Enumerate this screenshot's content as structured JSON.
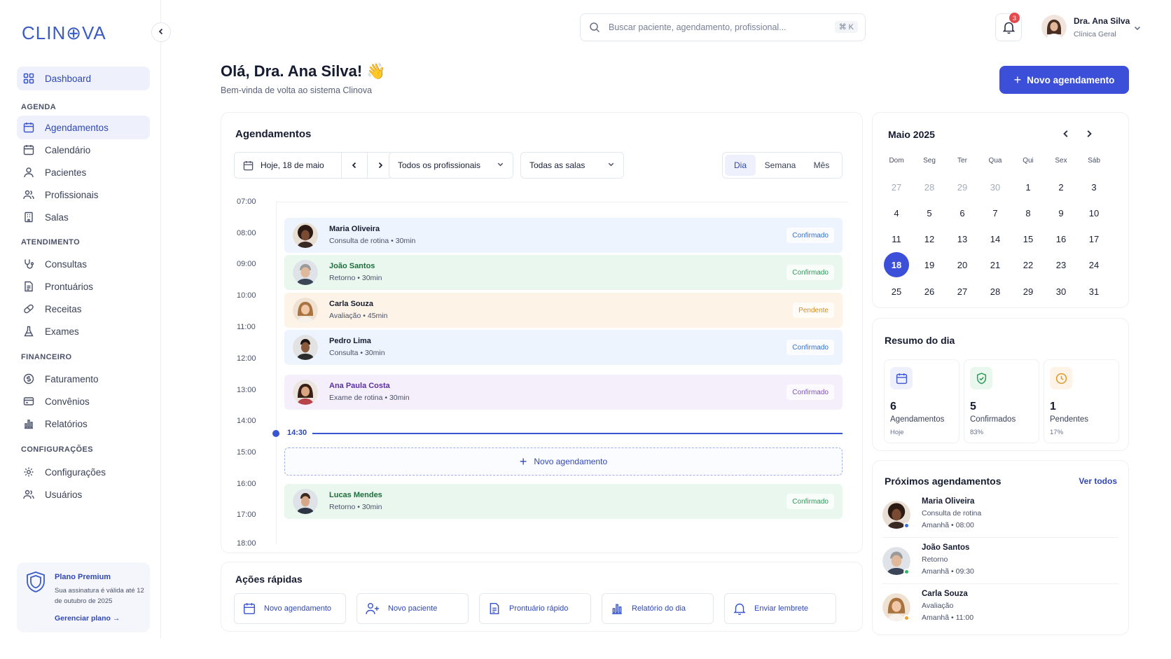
{
  "brand": {
    "logo": "CLIN⊕VA"
  },
  "sidebar": {
    "dashboard": "Dashboard",
    "sections": {
      "agenda": "AGENDA",
      "atendimento": "ATENDIMENTO",
      "financeiro": "FINANCEIRO",
      "config": "CONFIGURAÇÕES"
    },
    "items": {
      "agendamentos": "Agendamentos",
      "calendario": "Calendário",
      "pacientes": "Pacientes",
      "profissionais": "Profissionais",
      "salas": "Salas",
      "consultas": "Consultas",
      "prontuarios": "Prontuários",
      "receitas": "Receitas",
      "exames": "Exames",
      "faturamento": "Faturamento",
      "convenios": "Convênios",
      "relatorios": "Relatórios",
      "configuracoes": "Configurações",
      "usuarios": "Usuários"
    },
    "plan": {
      "title": "Plano Premium",
      "text": "Sua assinatura é válida até 12 de outubro de 2025",
      "link": "Gerenciar plano →"
    }
  },
  "topbar": {
    "search_placeholder": "Buscar paciente, agendamento, profissional...",
    "search_shortcut": "⌘  K",
    "notifications": "3",
    "user_name": "Dra. Ana Silva",
    "user_role": "Clínica Geral"
  },
  "header": {
    "greeting": "Olá, Dra. Ana Silva! 👋",
    "subtitle": "Bem-vinda de volta ao sistema Clinova",
    "new_button": "Novo agendamento"
  },
  "schedule": {
    "title": "Agendamentos",
    "date_filter": "Hoje, 18 de maio",
    "professional_filter": "Todos os profissionais",
    "room_filter": "Todas as salas",
    "views": [
      "Dia",
      "Semana",
      "Mês"
    ],
    "times": [
      "07:00",
      "08:00",
      "09:00",
      "10:00",
      "11:00",
      "12:00",
      "13:00",
      "14:00",
      "15:00",
      "16:00",
      "17:00",
      "18:00"
    ],
    "now": "14:30",
    "add_slot": "Novo agendamento",
    "appointments": [
      {
        "name": "Maria Oliveira",
        "desc": "Consulta de rotina • 30min",
        "status": "Confirmado"
      },
      {
        "name": "João Santos",
        "desc": "Retorno • 30min",
        "status": "Confirmado"
      },
      {
        "name": "Carla Souza",
        "desc": "Avaliação • 45min",
        "status": "Pendente"
      },
      {
        "name": "Pedro Lima",
        "desc": "Consulta • 30min",
        "status": "Confirmado"
      },
      {
        "name": "Ana Paula Costa",
        "desc": "Exame de rotina • 30min",
        "status": "Confirmado"
      },
      {
        "name": "Lucas Mendes",
        "desc": "Retorno • 30min",
        "status": "Confirmado"
      }
    ]
  },
  "quick_actions": {
    "title": "Ações rápidas",
    "items": [
      "Novo agendamento",
      "Novo paciente",
      "Prontuário rápido",
      "Relatório do dia",
      "Enviar lembrete"
    ]
  },
  "calendar": {
    "month": "Maio 2025",
    "dow": [
      "Dom",
      "Seg",
      "Ter",
      "Qua",
      "Qui",
      "Sex",
      "Sáb"
    ],
    "days": [
      "27",
      "28",
      "29",
      "30",
      "1",
      "2",
      "3",
      "4",
      "5",
      "6",
      "7",
      "8",
      "9",
      "10",
      "11",
      "12",
      "13",
      "14",
      "15",
      "16",
      "17",
      "18",
      "19",
      "20",
      "21",
      "22",
      "23",
      "24",
      "25",
      "26",
      "27",
      "28",
      "29",
      "30",
      "31"
    ],
    "selected": "18"
  },
  "summary": {
    "title": "Resumo do dia",
    "boxes": [
      {
        "num": "6",
        "label": "Agendamentos",
        "sub": "Hoje"
      },
      {
        "num": "5",
        "label": "Confirmados",
        "sub": "83%"
      },
      {
        "num": "1",
        "label": "Pendentes",
        "sub": "17%"
      }
    ]
  },
  "upcoming": {
    "title": "Próximos agendamentos",
    "see_all": "Ver todos",
    "items": [
      {
        "name": "Maria Oliveira",
        "type": "Consulta de rotina",
        "when": "Amanhã • 08:00"
      },
      {
        "name": "João Santos",
        "type": "Retorno",
        "when": "Amanhã • 09:30"
      },
      {
        "name": "Carla Souza",
        "type": "Avaliação",
        "when": "Amanhã • 11:00"
      }
    ]
  },
  "colors": {
    "accent": "#3b4fd8",
    "confirmed_blue": "#2f6fd8",
    "confirmed_green": "#2b9a57",
    "pending": "#d98a1f",
    "purple": "#7e4fc4"
  }
}
